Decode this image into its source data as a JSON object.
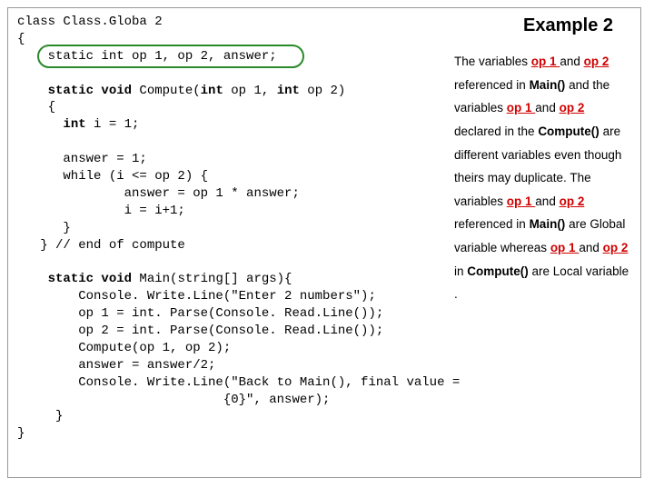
{
  "title": "Example 2",
  "code": {
    "l1": "class Class.Globa 2",
    "l2": "{",
    "l3": "    static int op 1, op 2, answer;",
    "l4": "",
    "l5": "    static void Compute(int op 1, int op 2)",
    "l6": "    {",
    "l7": "      int i = 1;",
    "l8": "",
    "l9": "      answer = 1;",
    "l10": "      while (i <= op 2) {",
    "l11": "              answer = op 1 * answer;",
    "l12": "              i = i+1;",
    "l13": "      }",
    "l14": "   } // end of compute",
    "l15": "",
    "l16": "    static void Main(string[] args){",
    "l17": "        Console. Write.Line(\"Enter 2 numbers\");",
    "l18": "        op 1 = int. Parse(Console. Read.Line());",
    "l19": "        op 2 = int. Parse(Console. Read.Line());",
    "l20": "        Compute(op 1, op 2);",
    "l21": "        answer = answer/2;",
    "l22": "        Console. Write.Line(\"Back to Main(), final value =",
    "l23": "                           {0}\", answer);",
    "l24": "     }",
    "l25": "}"
  },
  "desc": {
    "t1a": "The variables ",
    "op1": "op 1 ",
    "t1b": "and ",
    "op2": "op 2",
    "t2a": "referenced in ",
    "main": "Main()",
    "t2b": " and the",
    "t3a": "variables ",
    "t3b": "and ",
    "op2b": "op 2",
    "t4a": "declared in the ",
    "compute": "Compute()",
    "t5": "are different variables even",
    "t6": "though theirs may duplicate.",
    "t7a": "The variables ",
    "t7b": "and ",
    "t8a": "referenced in ",
    "t8b": " are",
    "t9a": "Global variable whereas ",
    "t10a": "and ",
    "t10b": " in ",
    "t10c": " are",
    "t11": "Local variable ."
  }
}
